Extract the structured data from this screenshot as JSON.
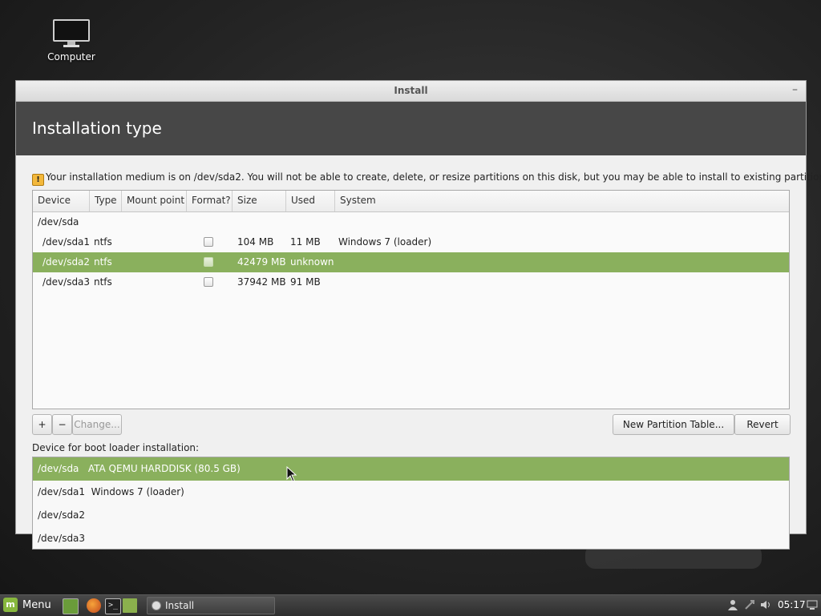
{
  "desktop": {
    "computer_label": "Computer"
  },
  "window": {
    "title": "Install",
    "minimize_glyph": "–",
    "heading": "Installation type"
  },
  "notice": {
    "icon": "warning-icon",
    "text": "Your installation medium is on /dev/sda2. You will not be able to create, delete, or resize partitions on this disk, but you may be able to install to existing partitions there."
  },
  "partition_table": {
    "columns": [
      "Device",
      "Type",
      "Mount point",
      "Format?",
      "Size",
      "Used",
      "System"
    ],
    "rows": [
      {
        "device": "/dev/sda",
        "type": "",
        "mount": "",
        "format": null,
        "size": "",
        "used": "",
        "system": ""
      },
      {
        "device": "/dev/sda1",
        "type": "ntfs",
        "mount": "",
        "format": false,
        "size": "104 MB",
        "used": "11 MB",
        "system": "Windows 7 (loader)"
      },
      {
        "device": "/dev/sda2",
        "type": "ntfs",
        "mount": "",
        "format": false,
        "size": "42479 MB",
        "used": "unknown",
        "system": ""
      },
      {
        "device": "/dev/sda3",
        "type": "ntfs",
        "mount": "",
        "format": false,
        "size": "37942 MB",
        "used": "91 MB",
        "system": ""
      }
    ],
    "selected_row": 2
  },
  "toolbar": {
    "add_glyph": "+",
    "remove_glyph": "−",
    "change_label": "Change...",
    "new_table_label": "New Partition Table...",
    "revert_label": "Revert"
  },
  "bootloader": {
    "label": "Device for boot loader installation:",
    "options": [
      "/dev/sda   ATA QEMU HARDDISK (80.5 GB)",
      "/dev/sda1  Windows 7 (loader)",
      "/dev/sda2",
      "/dev/sda3"
    ],
    "selected": 0
  },
  "taskbar": {
    "menu_label": "Menu",
    "task_label": "Install",
    "clock": "05:17"
  },
  "colors": {
    "selection": "#8ab05d",
    "header_bg": "#474747",
    "mint_green": "#87b73d"
  }
}
